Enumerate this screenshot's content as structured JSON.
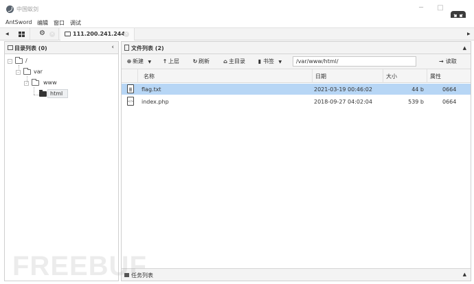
{
  "window": {
    "title": "中国蚁剑",
    "controls": {
      "minimize": "─",
      "maximize": "□"
    },
    "fullscreen_icon": "fullscreen-exit-icon"
  },
  "menubar": {
    "items": [
      "AntSword",
      "编辑",
      "窗口",
      "调试"
    ]
  },
  "tabbar": {
    "active_tab": "111.200.241.244"
  },
  "left_panel": {
    "title": "目录列表 (0)",
    "tree": {
      "root": "/",
      "level1": "var",
      "level2": "www",
      "level3": "html"
    }
  },
  "right_panel": {
    "title": "文件列表 (2)",
    "toolbar": {
      "new_label": "新建",
      "up_label": "上层",
      "refresh_label": "刷新",
      "home_label": "主目录",
      "bookmark_label": "书签",
      "path_value": "/var/www/html/",
      "read_label": "读取"
    },
    "columns": {
      "name": "名称",
      "date": "日期",
      "size": "大小",
      "attr": "属性"
    },
    "files": [
      {
        "name": "flag.txt",
        "date": "2021-03-19 00:46:02",
        "size": "44 b",
        "attr": "0664",
        "icon": "text-file-icon"
      },
      {
        "name": "index.php",
        "date": "2018-09-27 04:02:04",
        "size": "539 b",
        "attr": "0664",
        "icon": "code-file-icon"
      }
    ],
    "task_panel": {
      "title": "任务列表"
    }
  },
  "watermark": "FREEBUF",
  "colors": {
    "selected_row": "#b7d6f5",
    "panel_header": "#f3f3f3"
  }
}
